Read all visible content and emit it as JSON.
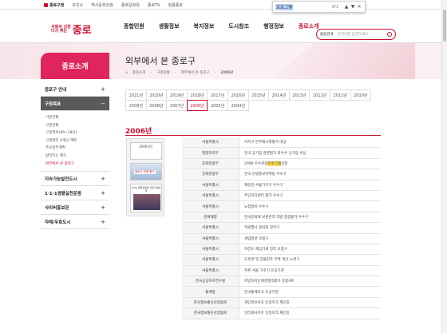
{
  "topbar": {
    "links": [
      "종로구청",
      "보건소",
      "역사문화관광",
      "종로문화원",
      "종로TV",
      "청렴종로"
    ]
  },
  "findbar": {
    "query": "프로그램",
    "count": "0/1",
    "prev": "▲",
    "next": "▼",
    "close": "✕"
  },
  "header": {
    "logo_small_1": "서울의 심장",
    "logo_small_2": "다시 뛰는",
    "logo_big": "종로",
    "gnb": [
      "종합민원",
      "생활정보",
      "복지정보",
      "도시창조",
      "행정정보",
      "종로소개"
    ],
    "search_select": "통합검색",
    "search_placeholder": "검색어를 입력하세요"
  },
  "lnb": {
    "title": "종로소개",
    "items": [
      {
        "label": "종로구 안내",
        "icon": "+"
      },
      {
        "label": "구정목표",
        "icon": "−"
      },
      {
        "label": "지속가능발전도시",
        "icon": "+"
      },
      {
        "label": "1·1·1생활실천운동",
        "icon": "+"
      },
      {
        "label": "사이버홍보관",
        "icon": "+"
      },
      {
        "label": "자매/우호도시",
        "icon": "+"
      }
    ],
    "sub": [
      "기본현황",
      "구정현황",
      "구정백서(09~18년)",
      "구정발전 4개년 계획",
      "주요업무계획",
      "탈라지는 제도",
      "외부에서 본 종로구"
    ]
  },
  "content": {
    "title": "외부에서 본 종로구",
    "breadcrumb": [
      "종로소개",
      "구정현황",
      "외부에서 본 종로구",
      "2006년"
    ],
    "years_row1": [
      "2021년",
      "2020년",
      "2019년",
      "2018년",
      "2017년",
      "2016년",
      "2015년",
      "2014년",
      "2013년",
      "2012년",
      "2011년",
      "2010년"
    ],
    "years_row2": [
      "2009년",
      "2008년",
      "2007년",
      "2006년",
      "2005년",
      "2004년"
    ],
    "active_year": "2006년",
    "section_title": "2006년",
    "poster": {
      "p1": "2006년도",
      "p2": "종로구 민원 평가",
      "p3": "2006 문화관광부 프로그램선정"
    },
    "rows": [
      [
        "서울특별시",
        "자치구 반부패시책평가 대상"
      ],
      [
        "행정자치부",
        "전국 공기업 경영평가 최우수 공기업 수상"
      ],
      [
        "문화관광부",
        "2006 우수관광",
        "프로그램",
        "선정"
      ],
      [
        "문화관광부",
        "전국 관광홍보마케팅 우수구"
      ],
      [
        "서울특별시",
        "깨끗한 서울가꾸기 우수구"
      ],
      [
        "서울특별시",
        "주민자치센터 평가 우수구"
      ],
      [
        "서울특별시",
        "노점정비 우수구"
      ],
      [
        "문화재청",
        "전국문화재 보존관리 역량 종합평가 우수구"
      ],
      [
        "서울특별시",
        "지원행사 협의회 장려구"
      ],
      [
        "서울특별시",
        "세입발굴 모범구"
      ],
      [
        "서울특별시",
        "자전도 체납기세 징리 모범구"
      ],
      [
        "서울특별시",
        "도로명 및 건물번호 부여 개선 노력구"
      ],
      [
        "서울특별시",
        "푸른 서울 가꾸기 유공기관"
      ],
      [
        "한국공공자치연구원",
        "지방자치단체경쟁력평가 종합4위"
      ],
      [
        "통계청",
        "전국통계조사 유공기관"
      ],
      [
        "한국정보통신산업협회",
        "개인정보보호 인증마크 제인증"
      ],
      [
        "한국정보통신산업협회",
        "인터넷사이트 인증마크 재인증"
      ]
    ]
  }
}
